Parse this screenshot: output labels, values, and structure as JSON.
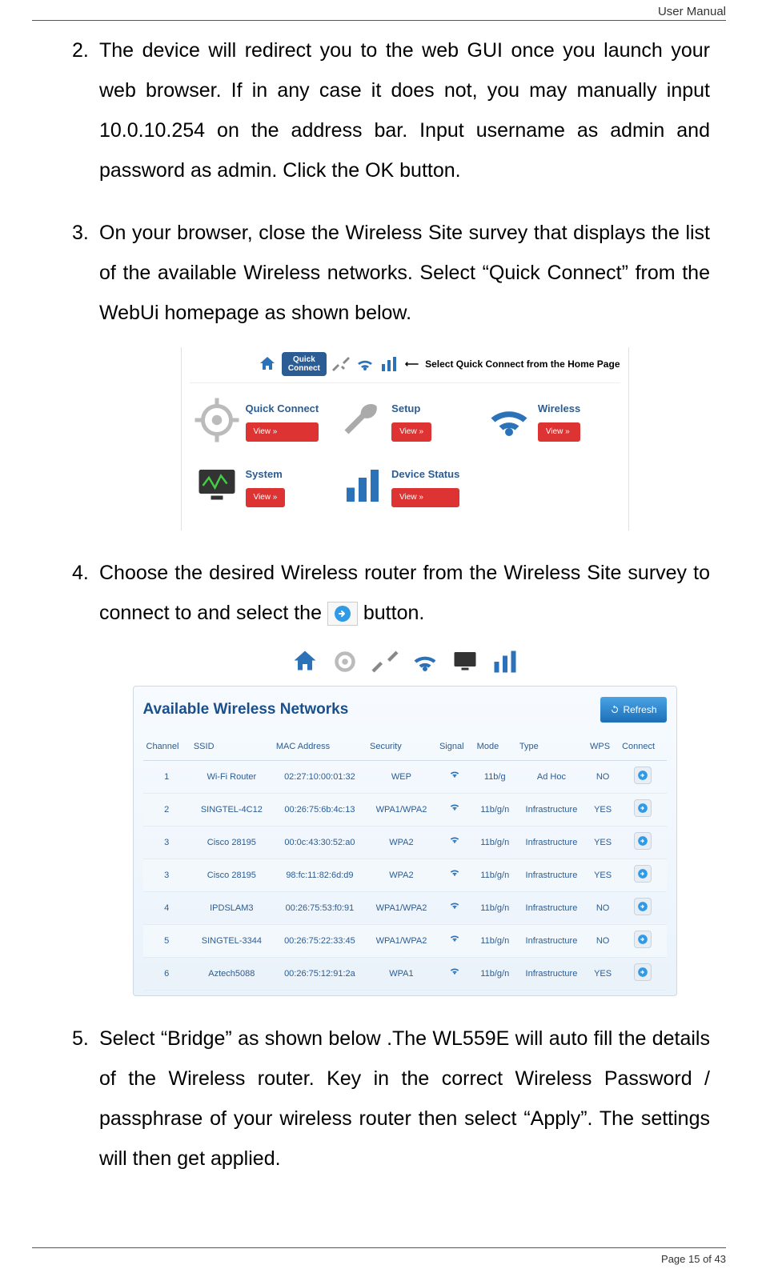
{
  "header": {
    "doc_title": "User Manual"
  },
  "footer": {
    "page_label": "Page 15 of 43"
  },
  "steps": {
    "s2": {
      "num": "2.",
      "text": "The device will redirect you to the web GUI once you launch your web browser. If in any case it does not, you may manually input 10.0.10.254 on the address bar. Input username as admin and password as admin. Click the OK button."
    },
    "s3": {
      "num": "3.",
      "text": "On your browser, close the Wireless Site survey that displays the list of the available Wireless networks. Select “Quick Connect” from the WebUi homepage as shown below."
    },
    "s4": {
      "num": "4.",
      "text_a": "Choose the desired Wireless router from the Wireless Site survey to connect to and select the ",
      "text_b": " button."
    },
    "s5": {
      "num": "5.",
      "text": "Select “Bridge” as shown below .The WL559E will auto fill the details of the Wireless router. Key in the correct Wireless Password / passphrase of your wireless router then select “Apply”. The settings will then get applied."
    }
  },
  "fig1": {
    "qc_pill_label": "Quick\nConnect",
    "callout": "Select Quick Connect from the Home Page",
    "view_label": "View »",
    "cards": [
      {
        "title": "Quick Connect"
      },
      {
        "title": "Setup"
      },
      {
        "title": "Wireless"
      },
      {
        "title": "System"
      },
      {
        "title": "Device Status"
      }
    ]
  },
  "fig2": {
    "title": "Available Wireless Networks",
    "refresh_label": "Refresh",
    "columns": [
      "Channel",
      "SSID",
      "MAC Address",
      "Security",
      "Signal",
      "Mode",
      "Type",
      "WPS",
      "Connect"
    ],
    "rows": [
      {
        "ch": "1",
        "ssid": "Wi-Fi Router",
        "mac": "02:27:10:00:01:32",
        "sec": "WEP",
        "mode": "11b/g",
        "type": "Ad Hoc",
        "wps": "NO"
      },
      {
        "ch": "2",
        "ssid": "SINGTEL-4C12",
        "mac": "00:26:75:6b:4c:13",
        "sec": "WPA1/WPA2",
        "mode": "11b/g/n",
        "type": "Infrastructure",
        "wps": "YES"
      },
      {
        "ch": "3",
        "ssid": "Cisco 28195",
        "mac": "00:0c:43:30:52:a0",
        "sec": "WPA2",
        "mode": "11b/g/n",
        "type": "Infrastructure",
        "wps": "YES"
      },
      {
        "ch": "3",
        "ssid": "Cisco 28195",
        "mac": "98:fc:11:82:6d:d9",
        "sec": "WPA2",
        "mode": "11b/g/n",
        "type": "Infrastructure",
        "wps": "YES"
      },
      {
        "ch": "4",
        "ssid": "IPDSLAM3",
        "mac": "00:26:75:53:f0:91",
        "sec": "WPA1/WPA2",
        "mode": "11b/g/n",
        "type": "Infrastructure",
        "wps": "NO"
      },
      {
        "ch": "5",
        "ssid": "SINGTEL-3344",
        "mac": "00:26:75:22:33:45",
        "sec": "WPA1/WPA2",
        "mode": "11b/g/n",
        "type": "Infrastructure",
        "wps": "NO"
      },
      {
        "ch": "6",
        "ssid": "Aztech5088",
        "mac": "00:26:75:12:91:2a",
        "sec": "WPA1",
        "mode": "11b/g/n",
        "type": "Infrastructure",
        "wps": "YES"
      }
    ]
  }
}
